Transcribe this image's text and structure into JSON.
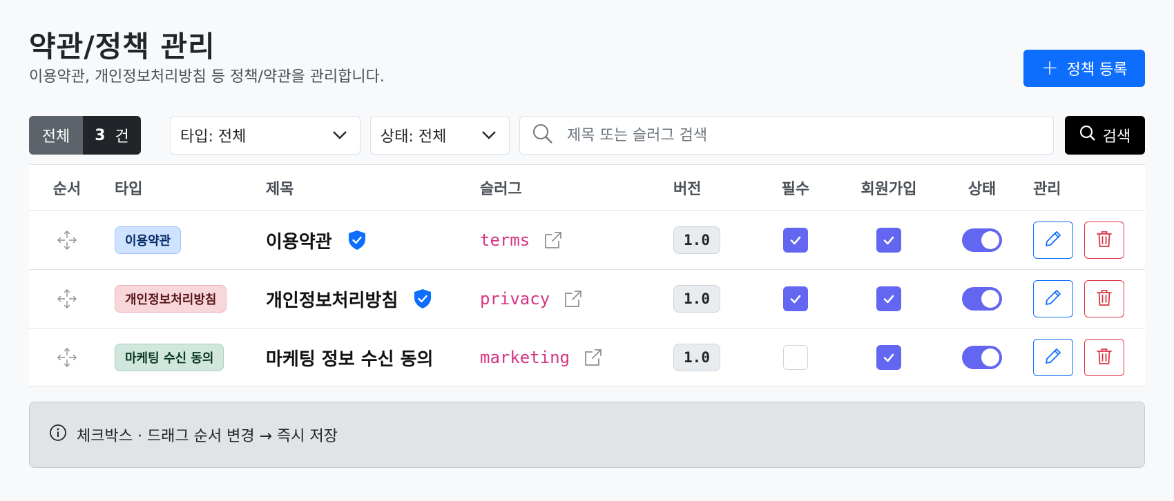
{
  "header": {
    "title": "약관/정책 관리",
    "subtitle": "이용약관, 개인정보처리방침 등 정책/약관을 관리합니다.",
    "add_button": "정책 등록"
  },
  "toolbar": {
    "count_label": "전체",
    "count_value": "3",
    "count_unit": "건",
    "type_filter": "타입: 전체",
    "status_filter": "상태: 전체",
    "search_placeholder": "제목 또는 슬러그 검색",
    "search_button": "검색"
  },
  "table": {
    "headers": {
      "order": "순서",
      "type": "타입",
      "title": "제목",
      "slug": "슬러그",
      "version": "버전",
      "required": "필수",
      "signup": "회원가입",
      "status": "상태",
      "manage": "관리"
    },
    "rows": [
      {
        "type": "이용약관",
        "type_color": "#cfe2ff",
        "type_border": "#9ec5fe",
        "type_text": "#052c65",
        "title": "이용약관",
        "verified": true,
        "slug": "terms",
        "version": "1.0",
        "required": true,
        "signup": true,
        "active": true
      },
      {
        "type": "개인정보처리방침",
        "type_color": "#f8d7da",
        "type_border": "#f1aeb5",
        "type_text": "#58151c",
        "title": "개인정보처리방침",
        "verified": true,
        "slug": "privacy",
        "version": "1.0",
        "required": true,
        "signup": true,
        "active": true
      },
      {
        "type": "마케팅 수신 동의",
        "type_color": "#d1e7dd",
        "type_border": "#a3cfbb",
        "type_text": "#0a3622",
        "title": "마케팅 정보 수신 동의",
        "verified": false,
        "slug": "marketing",
        "version": "1.0",
        "required": false,
        "signup": true,
        "active": true
      }
    ]
  },
  "info": {
    "text": "체크박스 · 드래그 순서 변경 → 즉시 저장"
  },
  "colors": {
    "primary": "#0d6efd",
    "accent": "#6366f1",
    "danger": "#dc3545",
    "slug": "#d63384"
  }
}
